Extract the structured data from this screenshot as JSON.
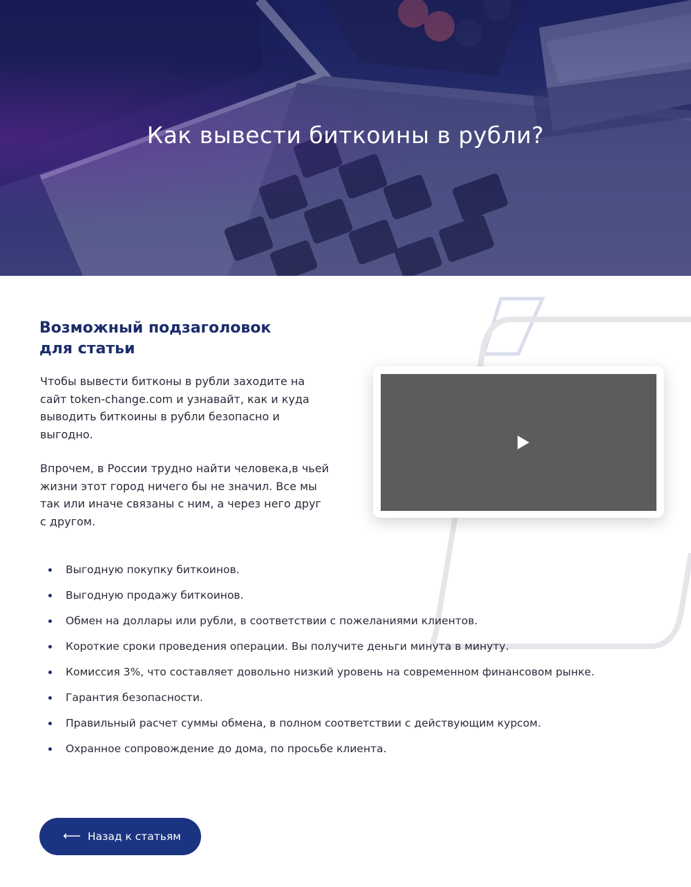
{
  "hero": {
    "title": "Как вывести биткоины в рубли?",
    "image": "laptop-keyboard-calculator-money-photo"
  },
  "article": {
    "subtitle_line1": "Возможный подзаголовок",
    "subtitle_line2": "для статьи",
    "paragraph1": "Чтобы вывести битконы в рубли заходите на сайт token-change.com и узнавайт, как и куда выводить биткоины в рубли безопасно и выгодно.",
    "paragraph2": "Впрочем, в России трудно найти человека,в чьей жизни этот город ничего бы не значил. Все мы так или иначе связаны с ним, а через него друг с другом.",
    "video": {
      "icon": "play-icon"
    },
    "features": [
      "Выгодную покупку биткоинов.",
      "Выгодную продажу биткоинов.",
      "Обмен на доллары или рубли, в соответствии с пожеланиями клиентов.",
      "Короткие сроки проведения операции. Вы получите деньги минута в минуту.",
      "Комиссия 3%, что составляет довольно низкий уровень на современном финансовом рынке.",
      "Гарантия безопасности.",
      "Правильный расчет суммы обмена, в полном соответствии с действующим курсом.",
      "Охранное сопровождение до дома, по просьбе клиента."
    ]
  },
  "back_button": {
    "arrow": "⟵",
    "label": "Назад к статьям"
  },
  "colors": {
    "brand_navy": "#1b3482",
    "subtitle": "#1b2c6b",
    "video_bg": "#5c5c5c"
  }
}
